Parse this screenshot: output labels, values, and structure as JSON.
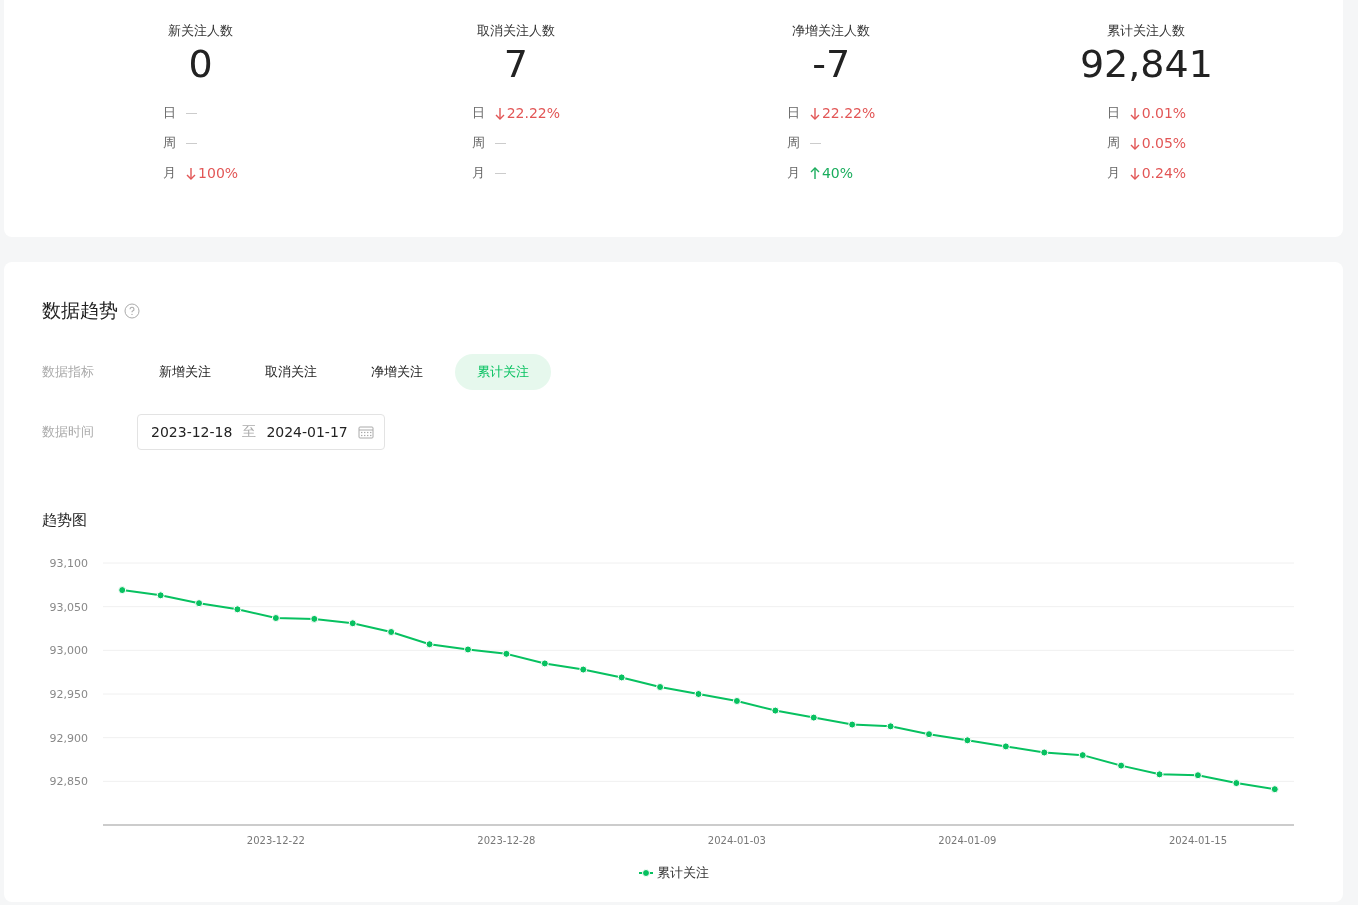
{
  "stats": [
    {
      "title": "新关注人数",
      "value": "0",
      "changes": [
        {
          "label": "日",
          "kind": "none"
        },
        {
          "label": "周",
          "kind": "none"
        },
        {
          "label": "月",
          "value": "100%",
          "kind": "down"
        }
      ]
    },
    {
      "title": "取消关注人数",
      "value": "7",
      "changes": [
        {
          "label": "日",
          "value": "22.22%",
          "kind": "down"
        },
        {
          "label": "周",
          "kind": "none"
        },
        {
          "label": "月",
          "kind": "none"
        }
      ]
    },
    {
      "title": "净增关注人数",
      "value": "-7",
      "changes": [
        {
          "label": "日",
          "value": "22.22%",
          "kind": "down"
        },
        {
          "label": "周",
          "kind": "none"
        },
        {
          "label": "月",
          "value": "40%",
          "kind": "up"
        }
      ]
    },
    {
      "title": "累计关注人数",
      "value": "92,841",
      "changes": [
        {
          "label": "日",
          "value": "0.01%",
          "kind": "down"
        },
        {
          "label": "周",
          "value": "0.05%",
          "kind": "down"
        },
        {
          "label": "月",
          "value": "0.24%",
          "kind": "down"
        }
      ]
    }
  ],
  "trend": {
    "title": "数据趋势",
    "metric_label": "数据指标",
    "metrics": [
      {
        "label": "新增关注",
        "selected": false
      },
      {
        "label": "取消关注",
        "selected": false
      },
      {
        "label": "净增关注",
        "selected": false
      },
      {
        "label": "累计关注",
        "selected": true
      }
    ],
    "time_label": "数据时间",
    "date_range": {
      "start": "2023-12-18",
      "separator": "至",
      "end": "2024-01-17"
    },
    "chart_title": "趋势图",
    "chart_data": {
      "type": "line",
      "grid": true,
      "categories": [
        null,
        null,
        null,
        null,
        "2023-12-22",
        null,
        null,
        null,
        null,
        null,
        "2023-12-28",
        null,
        null,
        null,
        null,
        null,
        "2024-01-03",
        null,
        null,
        null,
        null,
        null,
        "2024-01-09",
        null,
        null,
        null,
        null,
        null,
        "2024-01-15",
        null,
        null
      ],
      "series": [
        {
          "name": "累计关注",
          "color": "#07c160",
          "marker": "circle",
          "values": [
            93069,
            93063,
            93054,
            93047,
            93037,
            93036,
            93031,
            93021,
            93007,
            93001,
            92996,
            92985,
            92978,
            92969,
            92958,
            92950,
            92942,
            92931,
            92923,
            92915,
            92913,
            92904,
            92897,
            92890,
            92883,
            92880,
            92868,
            92858,
            92857,
            92848,
            92841
          ]
        }
      ],
      "ylim": [
        92800,
        93100
      ],
      "yticks": [
        {
          "value": 92850,
          "label": "92,850"
        },
        {
          "value": 92900,
          "label": "92,900"
        },
        {
          "value": 92950,
          "label": "92,950"
        },
        {
          "value": 93000,
          "label": "93,000"
        },
        {
          "value": 93050,
          "label": "93,050"
        },
        {
          "value": 93100,
          "label": "93,100"
        }
      ]
    }
  }
}
